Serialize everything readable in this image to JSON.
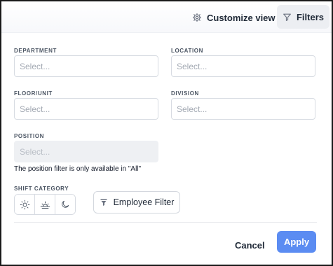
{
  "header": {
    "customize_label": "Customize view",
    "customize_icon": "gear-icon",
    "filters_label": "Filters",
    "filters_icon": "funnel-icon"
  },
  "fields": {
    "department": {
      "label": "DEPARTMENT",
      "placeholder": "Select..."
    },
    "location": {
      "label": "LOCATION",
      "placeholder": "Select..."
    },
    "floor_unit": {
      "label": "FLOOR/UNIT",
      "placeholder": "Select..."
    },
    "division": {
      "label": "DIVISION",
      "placeholder": "Select..."
    },
    "position": {
      "label": "POSITION",
      "placeholder": "Select...",
      "disabled": true,
      "note": "The position filter is only available in \"All\""
    }
  },
  "shift_category": {
    "label": "SHIFT CATEGORY",
    "options": [
      "sun-icon",
      "sunrise-icon",
      "moon-icon"
    ]
  },
  "employee_filter": {
    "label": "Employee Filter",
    "icon": "funnel-icon"
  },
  "footer": {
    "cancel_label": "Cancel",
    "apply_label": "Apply"
  },
  "colors": {
    "accent": "#5b8cf2",
    "panel_bg": "#ffffff",
    "disabled_bg": "#eef0f3"
  }
}
